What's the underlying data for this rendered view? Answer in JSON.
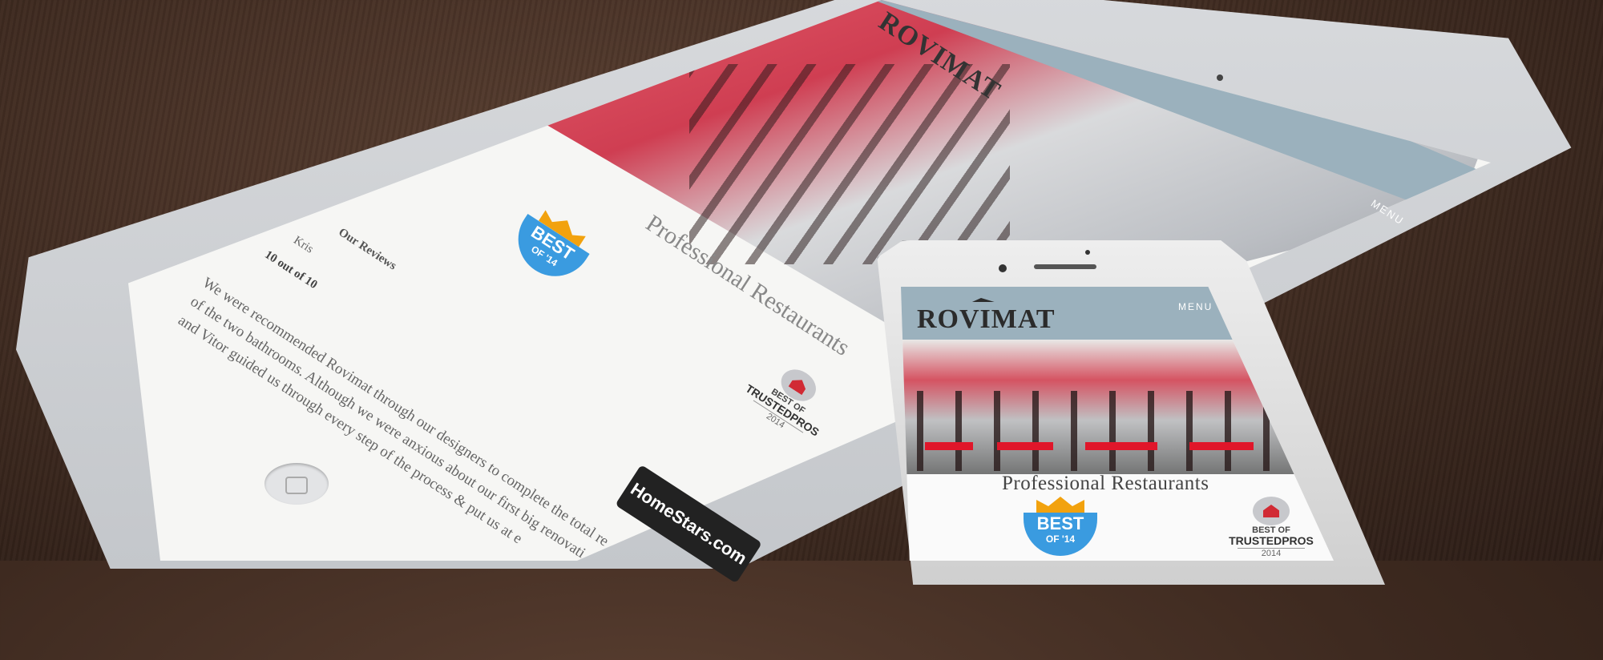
{
  "scene": {
    "description_tags": [
      "tablet-mockup",
      "phone-mockup",
      "wood-table"
    ]
  },
  "tablet": {
    "logo": "ROVIMAT",
    "menu_label": "MENU",
    "heading": "Professional Restaurants",
    "reviews_title": "Our Reviews",
    "reviewer": "Kris",
    "score": "10 out of 10",
    "review_lines": [
      "We were recommended Rovimat through our designers to complete the total re",
      "of the two bathrooms. Although we were anxious about our first big renovati",
      "and Vitor guided us through every step of the process & put us at e"
    ],
    "best_badge": {
      "title": "BEST",
      "subtitle": "OF '14"
    },
    "trusted_badge": {
      "top": "BEST OF",
      "middle": "TRUSTEDPROS",
      "year": "2014"
    },
    "homestars": "HomeStars.com"
  },
  "phone": {
    "logo": "ROVIMAT",
    "menu_label": "MENU",
    "heading": "Professional Restaurants",
    "best_badge": {
      "title": "BEST",
      "subtitle": "OF '14"
    },
    "trusted_badge": {
      "top": "BEST OF",
      "middle": "TRUSTEDPROS",
      "year": "2014"
    }
  },
  "colors": {
    "header_blue": "#9bb1bd",
    "accent_red": "#e0162a",
    "badge_blue": "#3a9be0",
    "badge_gold": "#f2a20e"
  }
}
